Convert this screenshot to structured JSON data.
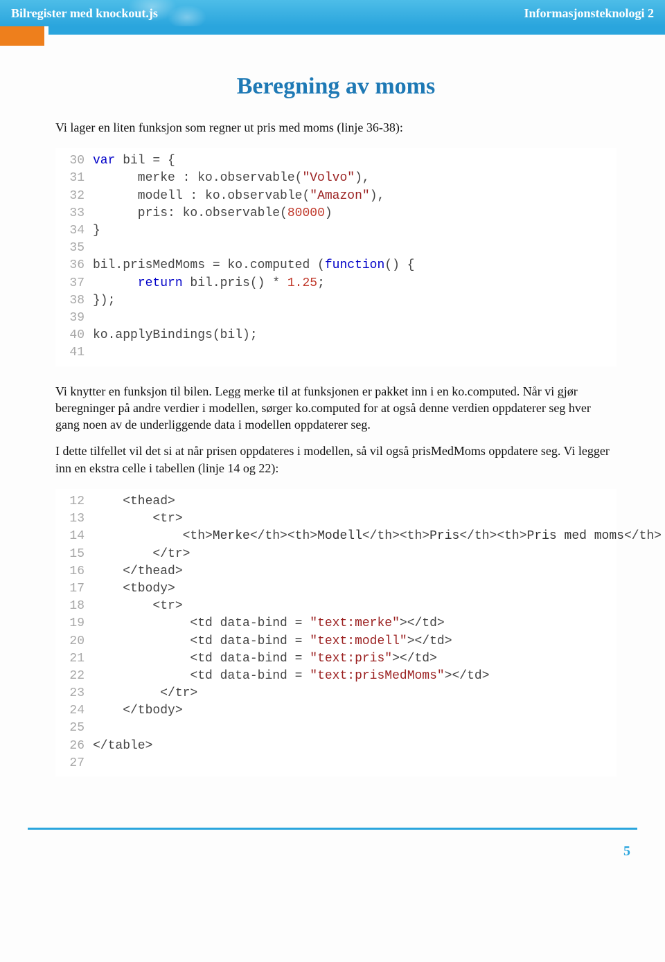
{
  "header": {
    "left": "Bilregister med knockout.js",
    "right": "Informasjonsteknologi 2"
  },
  "title": "Beregning av moms",
  "intro": "Vi lager en liten funksjon som regner ut pris med moms (linje 36-38):",
  "code1": [
    {
      "n": "30",
      "t": "<span class='kw'>var</span> bil = {"
    },
    {
      "n": "31",
      "t": "      merke : ko.observable(<span class='str'>\"Volvo\"</span>),"
    },
    {
      "n": "32",
      "t": "      modell : ko.observable(<span class='str'>\"Amazon\"</span>),"
    },
    {
      "n": "33",
      "t": "      pris: ko.observable(<span class='num'>80000</span>)"
    },
    {
      "n": "34",
      "t": "}"
    },
    {
      "n": "35",
      "t": ""
    },
    {
      "n": "36",
      "t": "bil.prisMedMoms = ko.computed (<span class='kw'>function</span>() {"
    },
    {
      "n": "37",
      "t": "      <span class='kw'>return</span> bil.pris() * <span class='num'>1.25</span>;"
    },
    {
      "n": "38",
      "t": "});"
    },
    {
      "n": "39",
      "t": ""
    },
    {
      "n": "40",
      "t": "ko.applyBindings(bil);"
    },
    {
      "n": "41",
      "t": ""
    }
  ],
  "para2": "Vi knytter en funksjon til bilen. Legg merke til at funksjonen er pakket inn i en ko.computed. Når vi gjør beregninger på andre verdier i modellen, sørger ko.computed for at også denne verdien oppdaterer seg hver gang noen av de underliggende data i modellen oppdaterer seg.",
  "para3": "I dette tilfellet vil det si at når prisen oppdateres i modellen, så vil også prisMedMoms oppdatere seg. Vi legger inn en ekstra celle i tabellen (linje 14 og 22):",
  "code2": [
    {
      "n": "12",
      "t": "    &lt;thead&gt;"
    },
    {
      "n": "13",
      "t": "        &lt;tr&gt;"
    },
    {
      "n": "14",
      "t": "            &lt;th&gt;<span class='id'>Merke</span>&lt;/th&gt;&lt;th&gt;<span class='id'>Modell</span>&lt;/th&gt;&lt;th&gt;<span class='id'>Pris</span>&lt;/th&gt;&lt;th&gt;<span class='id'>Pris med moms</span>&lt;/th&gt;"
    },
    {
      "n": "15",
      "t": "        &lt;/tr&gt;"
    },
    {
      "n": "16",
      "t": "    &lt;/thead&gt;"
    },
    {
      "n": "17",
      "t": "    &lt;tbody&gt;"
    },
    {
      "n": "18",
      "t": "        &lt;tr&gt;"
    },
    {
      "n": "19",
      "t": "             &lt;td data-bind = <span class='str'>\"text:merke\"</span>&gt;&lt;/td&gt;"
    },
    {
      "n": "20",
      "t": "             &lt;td data-bind = <span class='str'>\"text:modell\"</span>&gt;&lt;/td&gt;"
    },
    {
      "n": "21",
      "t": "             &lt;td data-bind = <span class='str'>\"text:pris\"</span>&gt;&lt;/td&gt;"
    },
    {
      "n": "22",
      "t": "             &lt;td data-bind = <span class='str'>\"text:prisMedMoms\"</span>&gt;&lt;/td&gt;"
    },
    {
      "n": "23",
      "t": "         &lt;/tr&gt;"
    },
    {
      "n": "24",
      "t": "    &lt;/tbody&gt;"
    },
    {
      "n": "25",
      "t": ""
    },
    {
      "n": "26",
      "t": "&lt;/table&gt;"
    },
    {
      "n": "27",
      "t": ""
    }
  ],
  "page_number": "5"
}
